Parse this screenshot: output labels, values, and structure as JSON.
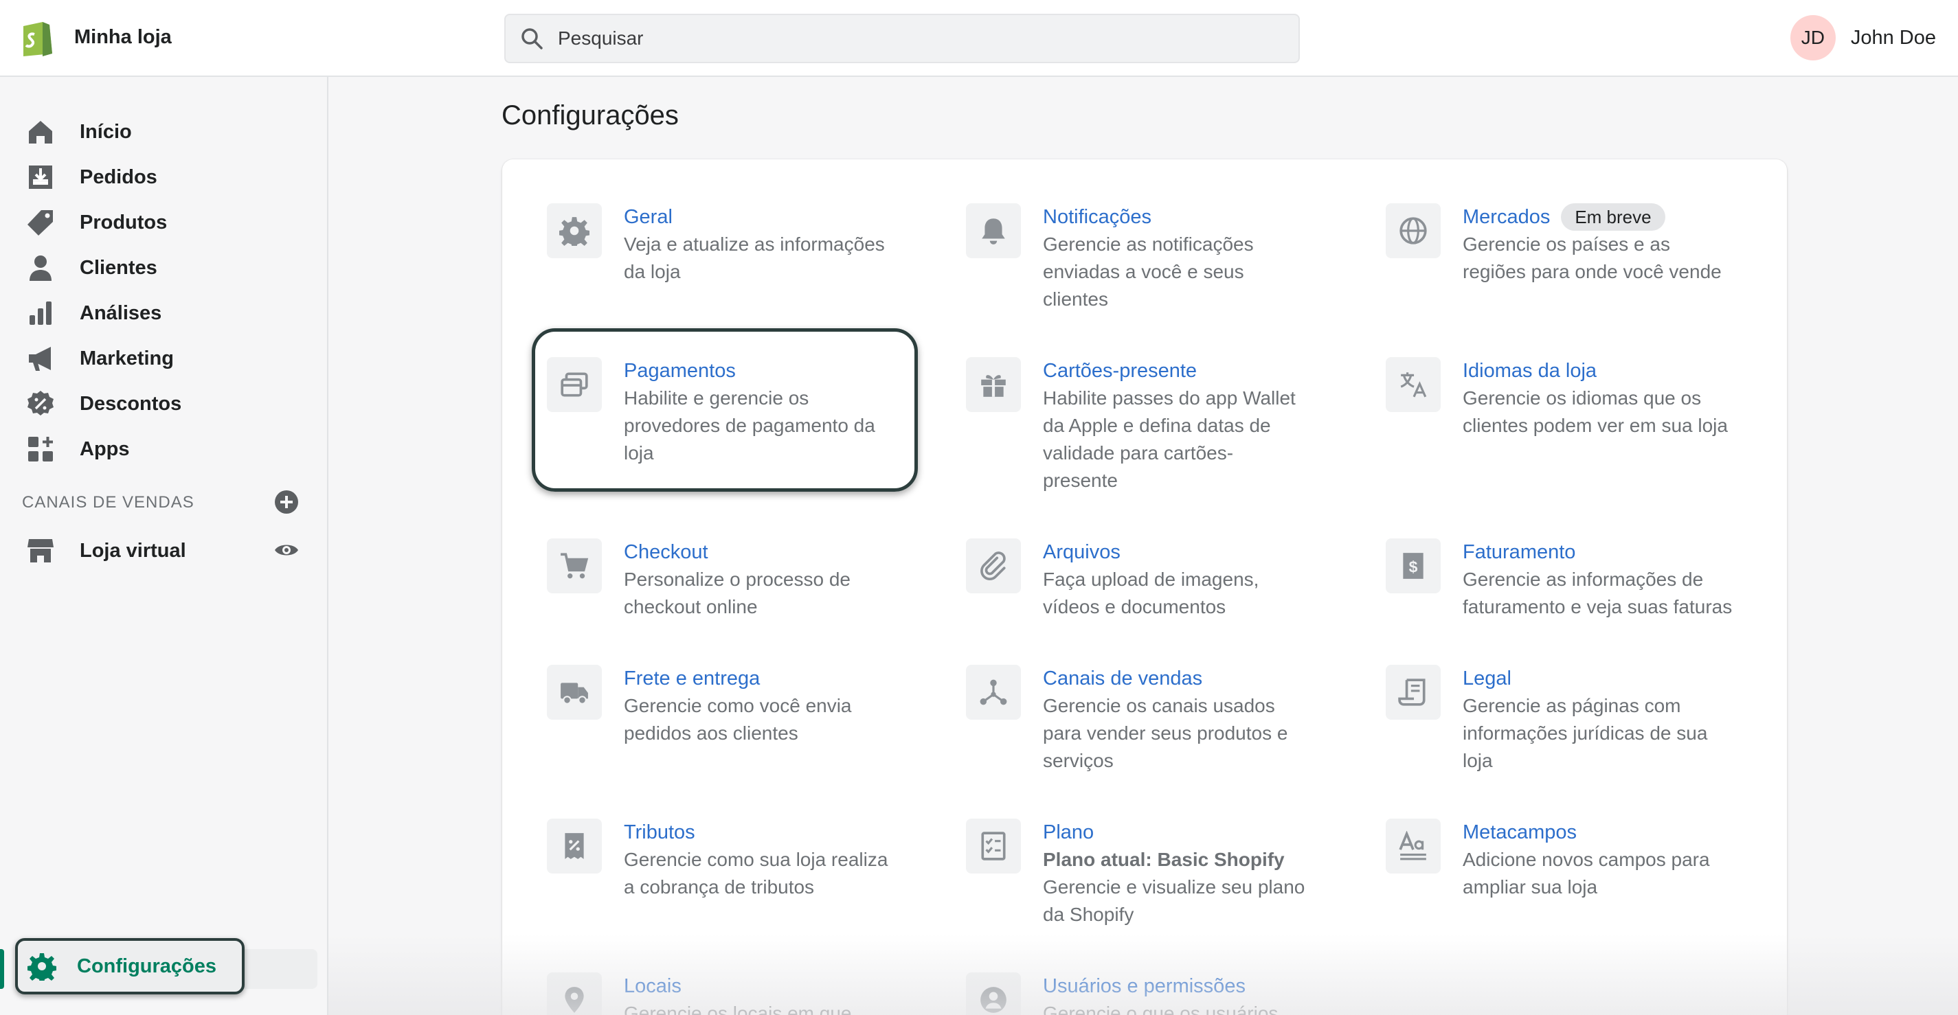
{
  "topbar": {
    "store_name": "Minha loja",
    "search_placeholder": "Pesquisar",
    "user_initials": "JD",
    "user_name": "John Doe"
  },
  "sidebar": {
    "items": [
      {
        "label": "Início",
        "icon": "home-icon"
      },
      {
        "label": "Pedidos",
        "icon": "orders-icon"
      },
      {
        "label": "Produtos",
        "icon": "tag-icon"
      },
      {
        "label": "Clientes",
        "icon": "person-icon"
      },
      {
        "label": "Análises",
        "icon": "bar-chart-icon"
      },
      {
        "label": "Marketing",
        "icon": "megaphone-icon"
      },
      {
        "label": "Descontos",
        "icon": "discount-icon"
      },
      {
        "label": "Apps",
        "icon": "apps-icon"
      }
    ],
    "sales_channels_title": "CANAIS DE VENDAS",
    "online_store": "Loja virtual",
    "settings": "Configurações"
  },
  "main": {
    "title": "Configurações",
    "settings": [
      {
        "title": "Geral",
        "desc": [
          "Veja e atualize as informações",
          "da loja"
        ]
      },
      {
        "title": "Notificações",
        "desc": [
          "Gerencie as notificações",
          "enviadas a você e seus",
          "clientes"
        ]
      },
      {
        "title": "Mercados",
        "badge": "Em breve",
        "desc": [
          "Gerencie os países e as",
          "regiões para onde você vende"
        ]
      },
      {
        "title": "Pagamentos",
        "desc": [
          "Habilite e gerencie os",
          "provedores de pagamento da",
          "loja"
        ]
      },
      {
        "title": "Cartões-presente",
        "desc": [
          "Habilite passes do app Wallet",
          "da Apple e defina datas de",
          "validade para cartões-",
          "presente"
        ]
      },
      {
        "title": "Idiomas da loja",
        "desc": [
          "Gerencie os idiomas que os",
          "clientes podem ver em sua loja"
        ]
      },
      {
        "title": "Checkout",
        "desc": [
          "Personalize o processo de",
          "checkout online"
        ]
      },
      {
        "title": "Arquivos",
        "desc": [
          "Faça upload de imagens,",
          "vídeos e documentos"
        ]
      },
      {
        "title": "Faturamento",
        "desc": [
          "Gerencie as informações de",
          "faturamento e veja suas faturas"
        ]
      },
      {
        "title": "Frete e entrega",
        "desc": [
          "Gerencie como você envia",
          "pedidos aos clientes"
        ]
      },
      {
        "title": "Canais de vendas",
        "desc": [
          "Gerencie os canais usados",
          "para vender seus produtos e",
          "serviços"
        ]
      },
      {
        "title": "Legal",
        "desc": [
          "Gerencie as páginas com",
          "informações jurídicas de sua",
          "loja"
        ]
      },
      {
        "title": "Tributos",
        "desc": [
          "Gerencie como sua loja realiza",
          "a cobrança de tributos"
        ]
      },
      {
        "title": "Plano",
        "strong": "Plano atual: Basic Shopify",
        "desc": [
          "Gerencie e visualize seu plano",
          "da Shopify"
        ]
      },
      {
        "title": "Metacampos",
        "desc": [
          "Adicione novos campos para",
          "ampliar sua loja"
        ]
      },
      {
        "title": "Locais",
        "desc": [
          "Gerencie os locais em que"
        ]
      },
      {
        "title": "Usuários e permissões",
        "desc": [
          "Gerencie o que os usuários"
        ]
      }
    ]
  },
  "colors": {
    "accent_link": "#2c6ecb",
    "active_green": "#008060",
    "avatar_bg": "#fed3d1"
  }
}
